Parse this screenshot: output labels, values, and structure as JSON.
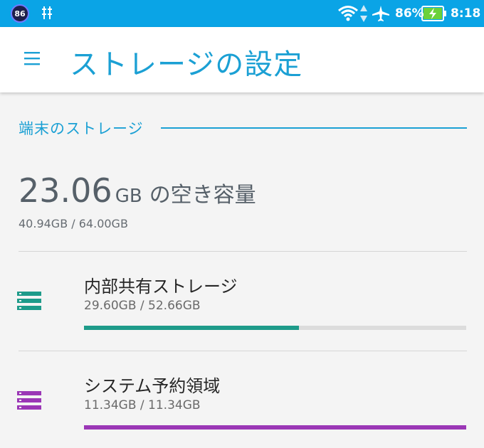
{
  "status_bar": {
    "badge": "86",
    "battery_percent": "86%",
    "time": "8:18",
    "icons": [
      "notification-badge-icon",
      "usb-debug-icon",
      "wifi-icon",
      "data-arrows-icon",
      "airplane-mode-icon",
      "battery-charging-icon"
    ],
    "background": "#0aa4e6"
  },
  "app_bar": {
    "title": "ストレージの設定",
    "menu_icon": "hamburger-menu-icon"
  },
  "device_storage": {
    "section_title": "端末のストレージ",
    "free_value": "23.06",
    "free_unit": "GB",
    "free_label": "の空き容量",
    "total_line": "40.94GB / 64.00GB"
  },
  "items": [
    {
      "name": "内部共有ストレージ",
      "usage": "29.60GB / 52.66GB",
      "fraction": 0.562,
      "color": "#1e9b8a",
      "icon": "storage-stack-icon"
    },
    {
      "name": "システム予約領域",
      "usage": "11.34GB / 11.34GB",
      "fraction": 1.0,
      "color": "#9b37b6",
      "icon": "storage-stack-icon"
    }
  ],
  "accent_color": "#1ba0d4"
}
